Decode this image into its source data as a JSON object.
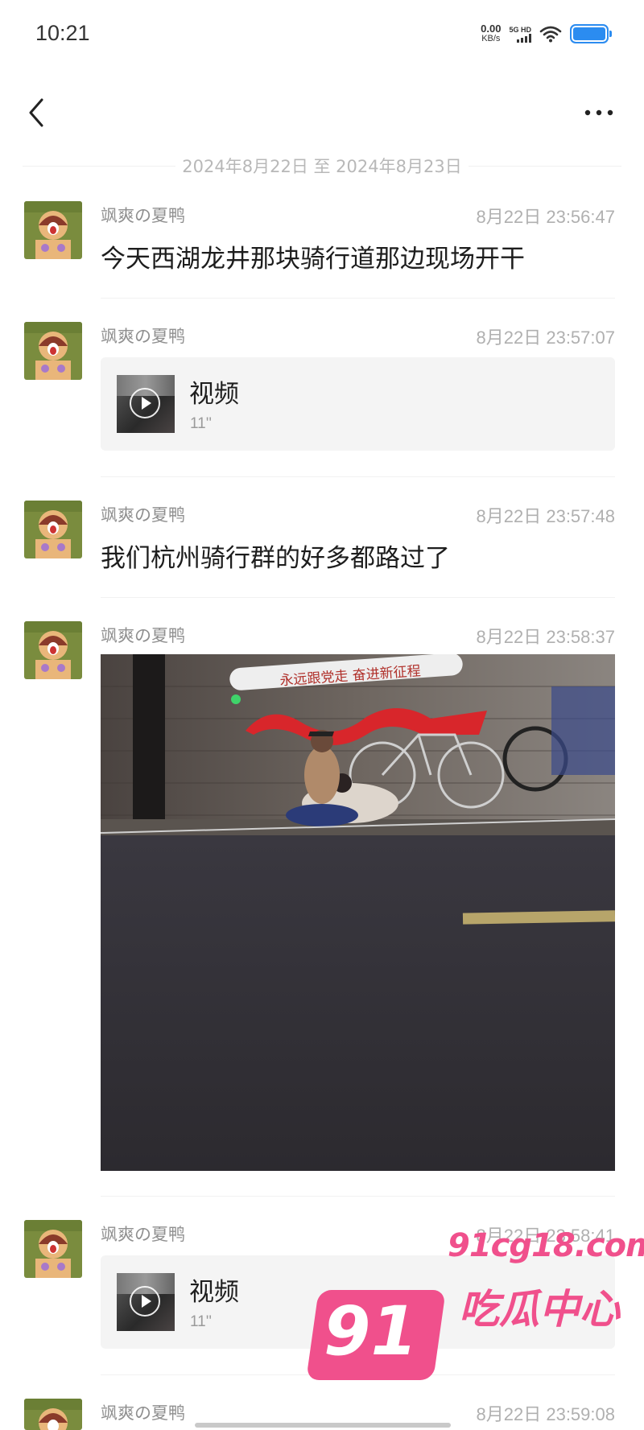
{
  "status_bar": {
    "time": "10:21",
    "net_speed": "0.00",
    "net_unit": "KB/s",
    "signal_tag": "5G HD"
  },
  "nav": {
    "back_icon": "back-chevron-icon",
    "more_icon": "more-dots-icon"
  },
  "date_range": "2024年8月22日 至 2024年8月23日",
  "messages": [
    {
      "sender": "飒爽の夏鸭",
      "time": "8月22日 23:56:47",
      "type": "text",
      "text": "今天西湖龙井那块骑行道那边现场开干"
    },
    {
      "sender": "飒爽の夏鸭",
      "time": "8月22日 23:57:07",
      "type": "video",
      "title": "视频",
      "duration": "11''"
    },
    {
      "sender": "飒爽の夏鸭",
      "time": "8月22日 23:57:48",
      "type": "text",
      "text": "我们杭州骑行群的好多都路过了"
    },
    {
      "sender": "飒爽の夏鸭",
      "time": "8月22日 23:58:37",
      "type": "image",
      "banner_text": "永远跟党走 奋进新征程"
    },
    {
      "sender": "飒爽の夏鸭",
      "time": "8月22日 23:58:41",
      "type": "video",
      "title": "视频",
      "duration": "11''"
    },
    {
      "sender": "飒爽の夏鸭",
      "time": "8月22日 23:59:08",
      "type": "partial"
    }
  ],
  "watermark": {
    "url": "91cg18.com",
    "number": "91",
    "name": "吃瓜中心"
  },
  "colors": {
    "accent_pink": "#f0508c",
    "battery_blue": "#2b8cf0"
  }
}
